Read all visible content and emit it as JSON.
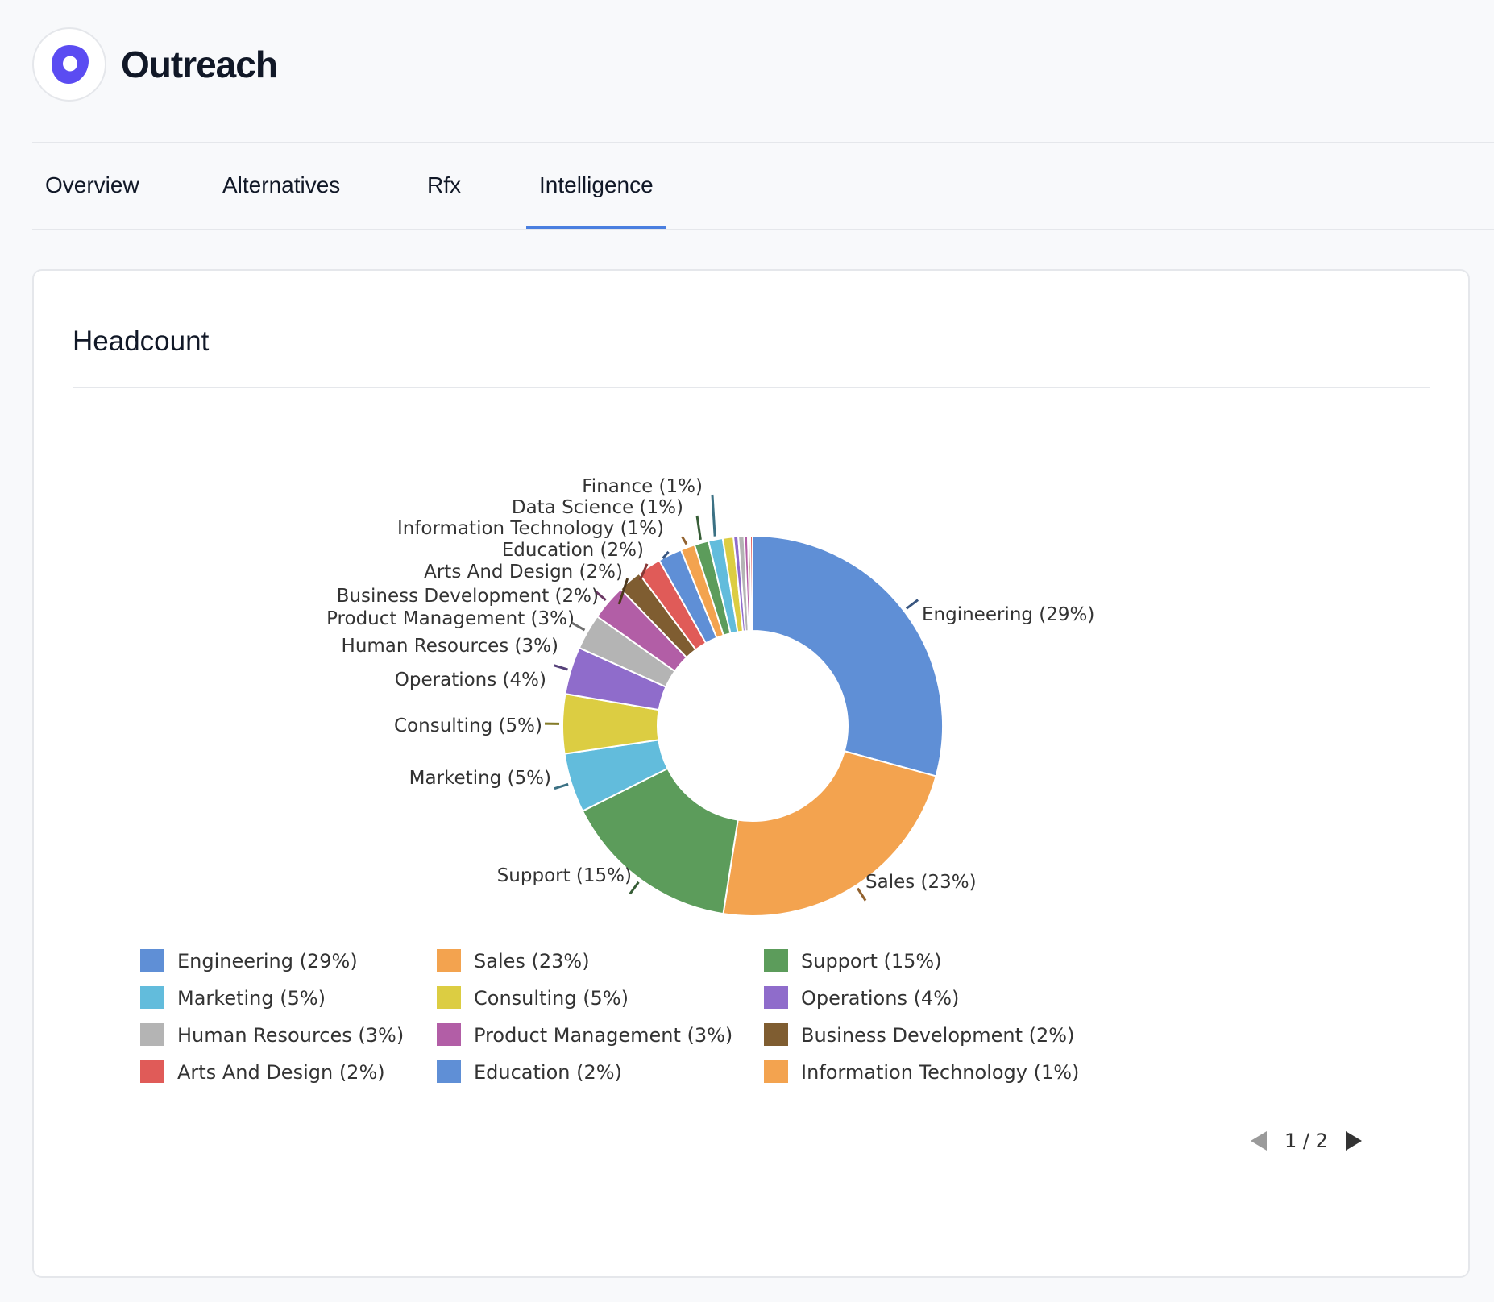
{
  "app": {
    "title": "Outreach",
    "logo_icon": "outreach-logo-icon",
    "brand_color": "#5b4cf2"
  },
  "tabs": [
    {
      "label": "Overview",
      "active": false
    },
    {
      "label": "Alternatives",
      "active": false
    },
    {
      "label": "Rfx",
      "active": false
    },
    {
      "label": "Intelligence",
      "active": true
    }
  ],
  "accent_color": "#4a7fe0",
  "card": {
    "title": "Headcount"
  },
  "chart_data": {
    "type": "pie",
    "donut": true,
    "legend_position": "bottom",
    "slices": [
      {
        "name": "Engineering",
        "label": "Engineering (29%)",
        "value": 29,
        "color": "#5f8fd6"
      },
      {
        "name": "Sales",
        "label": "Sales (23%)",
        "value": 23,
        "color": "#f3a34f"
      },
      {
        "name": "Support",
        "label": "Support (15%)",
        "value": 15,
        "color": "#5c9c5b"
      },
      {
        "name": "Marketing",
        "label": "Marketing (5%)",
        "value": 5,
        "color": "#62bcdc"
      },
      {
        "name": "Consulting",
        "label": "Consulting (5%)",
        "value": 5,
        "color": "#dccd42"
      },
      {
        "name": "Operations",
        "label": "Operations (4%)",
        "value": 4,
        "color": "#8f6ccb"
      },
      {
        "name": "Human Resources",
        "label": "Human Resources (3%)",
        "value": 3,
        "color": "#b4b4b4"
      },
      {
        "name": "Product Management",
        "label": "Product Management (3%)",
        "value": 3,
        "color": "#b25ea6"
      },
      {
        "name": "Business Development",
        "label": "Business Development (2%)",
        "value": 2,
        "color": "#7f5d31"
      },
      {
        "name": "Arts And Design",
        "label": "Arts And Design (2%)",
        "value": 2,
        "color": "#e05b58"
      },
      {
        "name": "Education",
        "label": "Education (2%)",
        "value": 2,
        "color": "#5f8fd6"
      },
      {
        "name": "Information Technology",
        "label": "Information Technology (1%)",
        "value": 1.2,
        "color": "#f3a34f"
      },
      {
        "name": "Data Science",
        "label": "Data Science (1%)",
        "value": 1.2,
        "color": "#5c9c5b"
      },
      {
        "name": "Finance",
        "label": "Finance (1%)",
        "value": 1.2,
        "color": "#62bcdc"
      },
      {
        "name": "",
        "label": "",
        "value": 0.9,
        "color": "#dccd42"
      },
      {
        "name": "",
        "label": "",
        "value": 0.4,
        "color": "#8f6ccb"
      },
      {
        "name": "",
        "label": "",
        "value": 0.5,
        "color": "#b4b4b4"
      },
      {
        "name": "",
        "label": "",
        "value": 0.3,
        "color": "#b25ea6"
      },
      {
        "name": "",
        "label": "",
        "value": 0.2,
        "color": "#7f5d31"
      },
      {
        "name": "",
        "label": "",
        "value": 0.2,
        "color": "#e05b58"
      }
    ]
  },
  "legend_pager": {
    "text": "1 / 2",
    "prev_icon": "triangle-left-icon",
    "next_icon": "triangle-right-icon"
  }
}
